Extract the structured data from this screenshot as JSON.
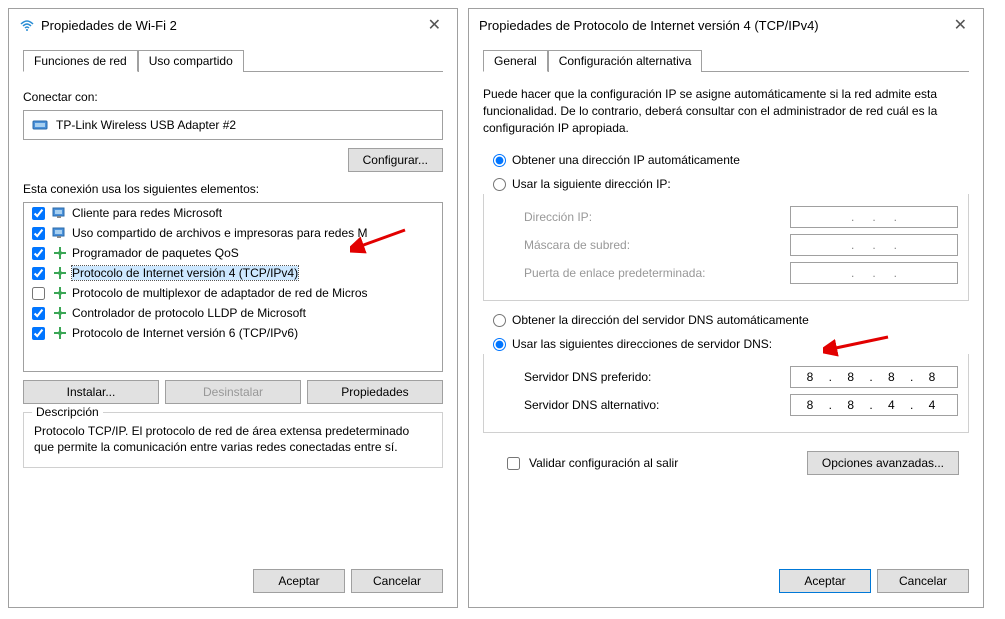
{
  "left": {
    "title": "Propiedades de Wi-Fi 2",
    "tabs": {
      "networking": "Funciones de red",
      "sharing": "Uso compartido"
    },
    "connect_with": "Conectar con:",
    "adapter": "TP-Link Wireless USB Adapter #2",
    "configure_btn": "Configurar...",
    "elements_label": "Esta conexión usa los siguientes elementos:",
    "items": [
      {
        "checked": true,
        "label": "Cliente para redes Microsoft",
        "icon": "pc"
      },
      {
        "checked": true,
        "label": "Uso compartido de archivos e impresoras para redes M",
        "icon": "pc"
      },
      {
        "checked": true,
        "label": "Programador de paquetes QoS",
        "icon": "proto"
      },
      {
        "checked": true,
        "label": "Protocolo de Internet versión 4 (TCP/IPv4)",
        "icon": "proto",
        "selected": true
      },
      {
        "checked": false,
        "label": "Protocolo de multiplexor de adaptador de red de Micros",
        "icon": "proto"
      },
      {
        "checked": true,
        "label": "Controlador de protocolo LLDP de Microsoft",
        "icon": "proto"
      },
      {
        "checked": true,
        "label": "Protocolo de Internet versión 6 (TCP/IPv6)",
        "icon": "proto"
      }
    ],
    "install_btn": "Instalar...",
    "uninstall_btn": "Desinstalar",
    "properties_btn": "Propiedades",
    "description_label": "Descripción",
    "description_text": "Protocolo TCP/IP. El protocolo de red de área extensa predeterminado que permite la comunicación entre varias redes conectadas entre sí.",
    "ok_btn": "Aceptar",
    "cancel_btn": "Cancelar"
  },
  "right": {
    "title": "Propiedades de Protocolo de Internet versión 4 (TCP/IPv4)",
    "tabs": {
      "general": "General",
      "alt": "Configuración alternativa"
    },
    "info": "Puede hacer que la configuración IP se asigne automáticamente si la red admite esta funcionalidad. De lo contrario, deberá consultar con el administrador de red cuál es la configuración IP apropiada.",
    "ip_auto": "Obtener una dirección IP automáticamente",
    "ip_manual": "Usar la siguiente dirección IP:",
    "ip_addr": "Dirección IP:",
    "subnet": "Máscara de subred:",
    "gateway": "Puerta de enlace predeterminada:",
    "dns_auto": "Obtener la dirección del servidor DNS automáticamente",
    "dns_manual": "Usar las siguientes direcciones de servidor DNS:",
    "dns_pref": "Servidor DNS preferido:",
    "dns_pref_val": "8 . 8 . 8 . 8",
    "dns_alt": "Servidor DNS alternativo:",
    "dns_alt_val": "8 . 8 . 4 . 4",
    "validate": "Validar configuración al salir",
    "advanced_btn": "Opciones avanzadas...",
    "ok_btn": "Aceptar",
    "cancel_btn": "Cancelar"
  }
}
